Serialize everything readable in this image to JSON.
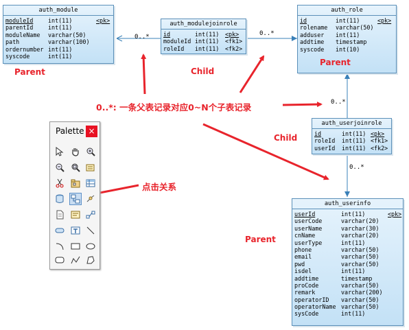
{
  "entities": {
    "auth_module": {
      "title": "auth_module",
      "columns": [
        {
          "name": "moduleId",
          "type": "int(11)",
          "key": "<pk>"
        },
        {
          "name": "parentId",
          "type": "int(11)",
          "key": ""
        },
        {
          "name": "moduleName",
          "type": "varchar(50)",
          "key": ""
        },
        {
          "name": "path",
          "type": "varchar(100)",
          "key": ""
        },
        {
          "name": "ordernumber",
          "type": "int(11)",
          "key": ""
        },
        {
          "name": "syscode",
          "type": "int(11)",
          "key": ""
        }
      ]
    },
    "auth_modulejoinrole": {
      "title": "auth_modulejoinrole",
      "columns": [
        {
          "name": "id",
          "type": "int(11)",
          "key": "<pk>"
        },
        {
          "name": "moduleId",
          "type": "int(11)",
          "key": "<fk1>"
        },
        {
          "name": "roleId",
          "type": "int(11)",
          "key": "<fk2>"
        }
      ]
    },
    "auth_role": {
      "title": "auth_role",
      "columns": [
        {
          "name": "id",
          "type": "int(11)",
          "key": "<pk>"
        },
        {
          "name": "rolename",
          "type": "varchar(50)",
          "key": ""
        },
        {
          "name": "adduser",
          "type": "int(11)",
          "key": ""
        },
        {
          "name": "addtime",
          "type": "timestamp",
          "key": ""
        },
        {
          "name": "syscode",
          "type": "int(10)",
          "key": ""
        }
      ]
    },
    "auth_userjoinrole": {
      "title": "auth_userjoinrole",
      "columns": [
        {
          "name": "id",
          "type": "int(11)",
          "key": "<pk>"
        },
        {
          "name": "roleId",
          "type": "int(11)",
          "key": "<fk1>"
        },
        {
          "name": "userId",
          "type": "int(11)",
          "key": "<fk2>"
        }
      ]
    },
    "auth_userinfo": {
      "title": "auth_userinfo",
      "columns": [
        {
          "name": "userId",
          "type": "int(11)",
          "key": "<pk>"
        },
        {
          "name": "userCode",
          "type": "varchar(20)",
          "key": ""
        },
        {
          "name": "userName",
          "type": "varchar(30)",
          "key": ""
        },
        {
          "name": "cnName",
          "type": "varchar(20)",
          "key": ""
        },
        {
          "name": "userType",
          "type": "int(11)",
          "key": ""
        },
        {
          "name": "phone",
          "type": "varchar(50)",
          "key": ""
        },
        {
          "name": "email",
          "type": "varchar(50)",
          "key": ""
        },
        {
          "name": "pwd",
          "type": "varchar(50)",
          "key": ""
        },
        {
          "name": "isdel",
          "type": "int(11)",
          "key": ""
        },
        {
          "name": "addtime",
          "type": "timestamp",
          "key": ""
        },
        {
          "name": "proCode",
          "type": "varchar(50)",
          "key": ""
        },
        {
          "name": "remark",
          "type": "varchar(200)",
          "key": ""
        },
        {
          "name": "operatorID",
          "type": "varchar(50)",
          "key": ""
        },
        {
          "name": "operatorName",
          "type": "varchar(50)",
          "key": ""
        },
        {
          "name": "sysCode",
          "type": "int(11)",
          "key": ""
        }
      ]
    }
  },
  "multiplicity": {
    "m1": "0..*",
    "m2": "0..*",
    "m3": "0..*",
    "m4": "0..*"
  },
  "labels": {
    "parent_module": "Parent",
    "child_modulejoinrole": "Child",
    "parent_role": "Parent",
    "child_userjoinrole": "Child",
    "parent_userinfo": "Parent",
    "note": "0..*: 一条父表记录对应0~N个子表记录",
    "click_relation": "点击关系"
  },
  "palette": {
    "title": "Palette",
    "close": "×",
    "tools": [
      "pointer-icon",
      "hand-icon",
      "zoom-in-icon",
      "zoom-out-icon",
      "zoom-fit-icon",
      "properties-icon",
      "cut-icon",
      "package-icon",
      "table-icon",
      "view-icon",
      "reference-icon",
      "link-icon",
      "file-icon",
      "text-block-icon",
      "connector-icon",
      "rounded-shape-icon",
      "title-text-icon",
      "line-icon",
      "arc-icon",
      "rectangle-icon",
      "ellipse-icon",
      "rounded-rect-icon",
      "polyline-icon",
      "polygon-icon"
    ]
  },
  "colors": {
    "annotation": "#e8242c",
    "connector": "#3a80b8",
    "entity_border": "#5a8fb8"
  }
}
